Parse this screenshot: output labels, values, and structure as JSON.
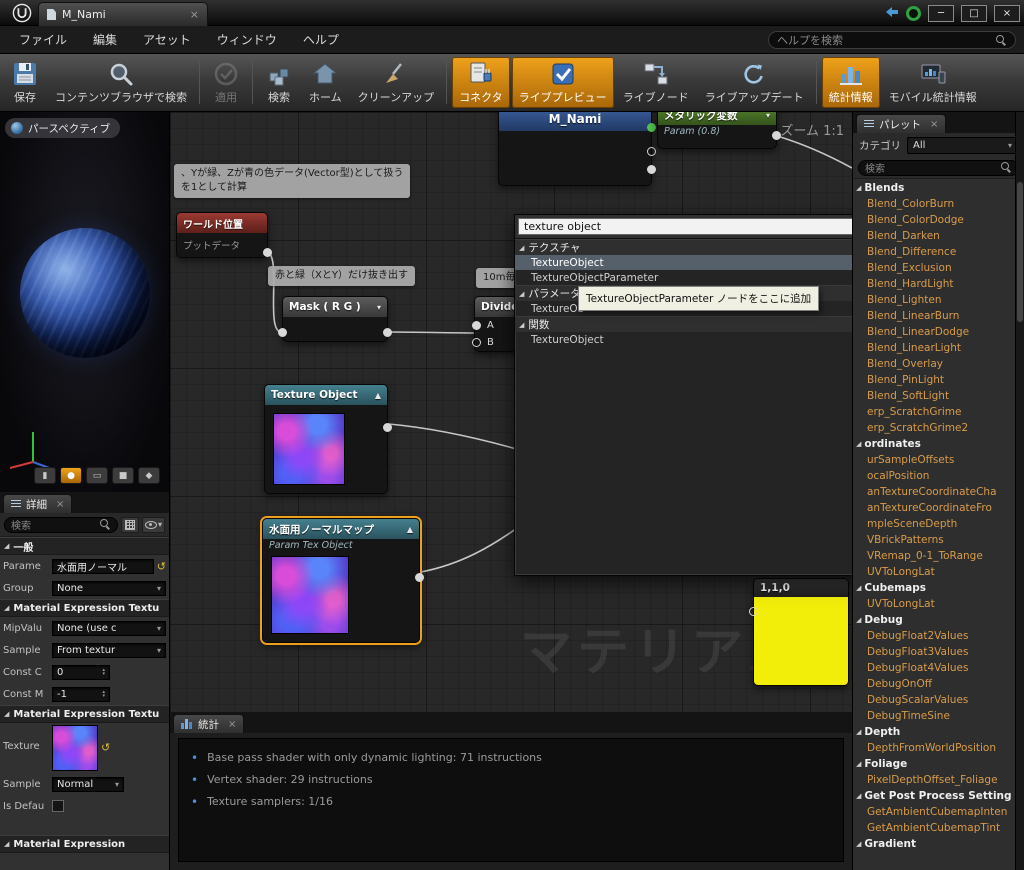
{
  "icons": {
    "close": "×",
    "minimize": "─",
    "maximize": "□",
    "dropdown_arrow": "▾",
    "collapse_arrow": "▲",
    "expander": "◢",
    "spin_up": "▴",
    "spin_down": "▾",
    "bullet": "•",
    "reset": "↺"
  },
  "titlebar": {
    "tab_label": "M_Nami"
  },
  "menubar": {
    "items": [
      "ファイル",
      "編集",
      "アセット",
      "ウィンドウ",
      "ヘルプ"
    ],
    "help_search_placeholder": "ヘルプを検索"
  },
  "toolbar": {
    "buttons": [
      {
        "label": "保存",
        "icon": "save-icon",
        "state": "normal"
      },
      {
        "label": "コンテンツブラウザで検索",
        "icon": "find-in-content-browser-icon",
        "state": "normal"
      },
      {
        "label": "適用",
        "icon": "apply-icon",
        "state": "disabled"
      },
      {
        "label": "検索",
        "icon": "search-icon",
        "state": "normal"
      },
      {
        "label": "ホーム",
        "icon": "home-icon",
        "state": "normal"
      },
      {
        "label": "クリーンアップ",
        "icon": "clean-up-icon",
        "state": "normal"
      },
      {
        "label": "コネクタ",
        "icon": "connectors-icon",
        "state": "active"
      },
      {
        "label": "ライブプレビュー",
        "icon": "live-preview-icon",
        "state": "active"
      },
      {
        "label": "ライブノード",
        "icon": "live-nodes-icon",
        "state": "normal"
      },
      {
        "label": "ライブアップデート",
        "icon": "live-update-icon",
        "state": "normal"
      },
      {
        "label": "統計情報",
        "icon": "stats-icon",
        "state": "active"
      },
      {
        "label": "モバイル統計情報",
        "icon": "mobile-stats-icon",
        "state": "normal"
      }
    ]
  },
  "viewport": {
    "mode_label": "パースペクティブ",
    "shape_buttons": [
      {
        "name": "cylinder",
        "glyph": "▮"
      },
      {
        "name": "sphere",
        "glyph": "●",
        "active": true
      },
      {
        "name": "plane",
        "glyph": "▭"
      },
      {
        "name": "cube",
        "glyph": "■"
      },
      {
        "name": "mesh",
        "glyph": "◆"
      }
    ]
  },
  "details": {
    "title": "詳細",
    "search_placeholder": "検索",
    "sections": {
      "general": "一般",
      "tex1": "Material Expression Textu",
      "tex2": "Material Expression Textu",
      "expr": "Material Expression"
    },
    "rows": {
      "param": {
        "label": "Parame",
        "value": "水面用ノーマル"
      },
      "group": {
        "label": "Group",
        "value": "None"
      },
      "mip": {
        "label": "MipValu",
        "value": "None (use c"
      },
      "sampler": {
        "label": "Sample",
        "value": "From textur"
      },
      "const_c": {
        "label": "Const C",
        "value": "0"
      },
      "const_m": {
        "label": "Const M",
        "value": "-1"
      },
      "texture": {
        "label": "Texture"
      },
      "sample_type": {
        "label": "Sample",
        "value": "Normal"
      },
      "is_default": {
        "label": "Is Defau"
      }
    }
  },
  "graph": {
    "zoom_label": "ズーム 1:1",
    "watermark": "マテリアル",
    "comment1_line1": "、Yが緑、Zが青の色データ(Vector型)として扱う",
    "comment1_line2": "を1として計算",
    "comment2": "赤と緑（XとY）だけ抜き出す",
    "comment3": "10m毎",
    "nodes": {
      "material": {
        "title": "M_Nami"
      },
      "metallic": {
        "title": "メタリック変数",
        "subtitle": "Param (0.8)"
      },
      "world_position": {
        "title": "ワールド位置",
        "body": "プットデータ"
      },
      "mask": {
        "title": "Mask ( R G )"
      },
      "divide": {
        "title": "Divide",
        "pin_a": "A",
        "pin_b": "B"
      },
      "texture_object": {
        "title": "Texture Object"
      },
      "normal_param": {
        "title": "水面用ノーマルマップ",
        "subtitle": "Param Tex Object"
      },
      "constant": {
        "title": "1,1,0"
      }
    }
  },
  "context_menu": {
    "search_value": "texture object",
    "rows": [
      {
        "type": "category",
        "label": "テクスチャ"
      },
      {
        "type": "item",
        "label": "TextureObject",
        "state": "selected"
      },
      {
        "type": "item",
        "label": "TextureObjectParameter",
        "state": "normal"
      },
      {
        "type": "category",
        "label": "パラメータ"
      },
      {
        "type": "item",
        "label": "TextureOb",
        "state": "normal"
      },
      {
        "type": "category",
        "label": "関数"
      },
      {
        "type": "item",
        "label": "TextureObject",
        "state": "normal"
      }
    ],
    "tooltip": "TextureObjectParameter ノードをここに追加"
  },
  "stats": {
    "title": "統計",
    "lines": [
      "Base pass shader with only dynamic lighting: 71 instructions",
      "Vertex shader: 29 instructions",
      "Texture samplers: 1/16"
    ]
  },
  "palette": {
    "title": "パレット",
    "category_label": "カテゴリ",
    "category_value": "All",
    "search_placeholder": "検索",
    "rows": [
      {
        "type": "category",
        "label": "Blends"
      },
      {
        "type": "item",
        "label": "Blend_ColorBurn"
      },
      {
        "type": "item",
        "label": "Blend_ColorDodge"
      },
      {
        "type": "item",
        "label": "Blend_Darken"
      },
      {
        "type": "item",
        "label": "Blend_Difference"
      },
      {
        "type": "item",
        "label": "Blend_Exclusion"
      },
      {
        "type": "item",
        "label": "Blend_HardLight"
      },
      {
        "type": "item",
        "label": "Blend_Lighten"
      },
      {
        "type": "item",
        "label": "Blend_LinearBurn"
      },
      {
        "type": "item",
        "label": "Blend_LinearDodge"
      },
      {
        "type": "item",
        "label": "Blend_LinearLight"
      },
      {
        "type": "item",
        "label": "Blend_Overlay"
      },
      {
        "type": "item",
        "label": "Blend_PinLight"
      },
      {
        "type": "item",
        "label": "Blend_SoftLight"
      },
      {
        "type": "item",
        "label": "erp_ScratchGrime"
      },
      {
        "type": "item",
        "label": "erp_ScratchGrime2"
      },
      {
        "type": "category",
        "label": "ordinates"
      },
      {
        "type": "item",
        "label": "urSampleOffsets"
      },
      {
        "type": "item",
        "label": "ocalPosition"
      },
      {
        "type": "item",
        "label": "anTextureCoordinateCha"
      },
      {
        "type": "item",
        "label": "anTextureCoordinateFro"
      },
      {
        "type": "item",
        "label": "mpleSceneDepth"
      },
      {
        "type": "item",
        "label": "VBrickPatterns"
      },
      {
        "type": "item",
        "label": "VRemap_0-1_ToRange"
      },
      {
        "type": "item",
        "label": "UVToLongLat"
      },
      {
        "type": "category",
        "label": "Cubemaps"
      },
      {
        "type": "item",
        "label": "UVToLongLat"
      },
      {
        "type": "category",
        "label": "Debug"
      },
      {
        "type": "item",
        "label": "DebugFloat2Values"
      },
      {
        "type": "item",
        "label": "DebugFloat3Values"
      },
      {
        "type": "item",
        "label": "DebugFloat4Values"
      },
      {
        "type": "item",
        "label": "DebugOnOff"
      },
      {
        "type": "item",
        "label": "DebugScalarValues"
      },
      {
        "type": "item",
        "label": "DebugTimeSine"
      },
      {
        "type": "category",
        "label": "Depth"
      },
      {
        "type": "item",
        "label": "DepthFromWorldPosition"
      },
      {
        "type": "category",
        "label": "Foliage"
      },
      {
        "type": "item",
        "label": "PixelDepthOffset_Foliage"
      },
      {
        "type": "category",
        "label": "Get Post Process Setting"
      },
      {
        "type": "item",
        "label": "GetAmbientCubemapInten"
      },
      {
        "type": "item",
        "label": "GetAmbientCubemapTint"
      },
      {
        "type": "category",
        "label": "Gradient"
      }
    ]
  },
  "colors": {
    "accent_orange": "#e8930c",
    "node_teal": "#45808f",
    "node_red": "#9a3a32",
    "node_green": "#55842e",
    "node_blue": "#3a5f9e",
    "constant_yellow": "#f2ee0a",
    "palette_item_text": "#d99c4a",
    "wire": "#d8d8d8"
  }
}
